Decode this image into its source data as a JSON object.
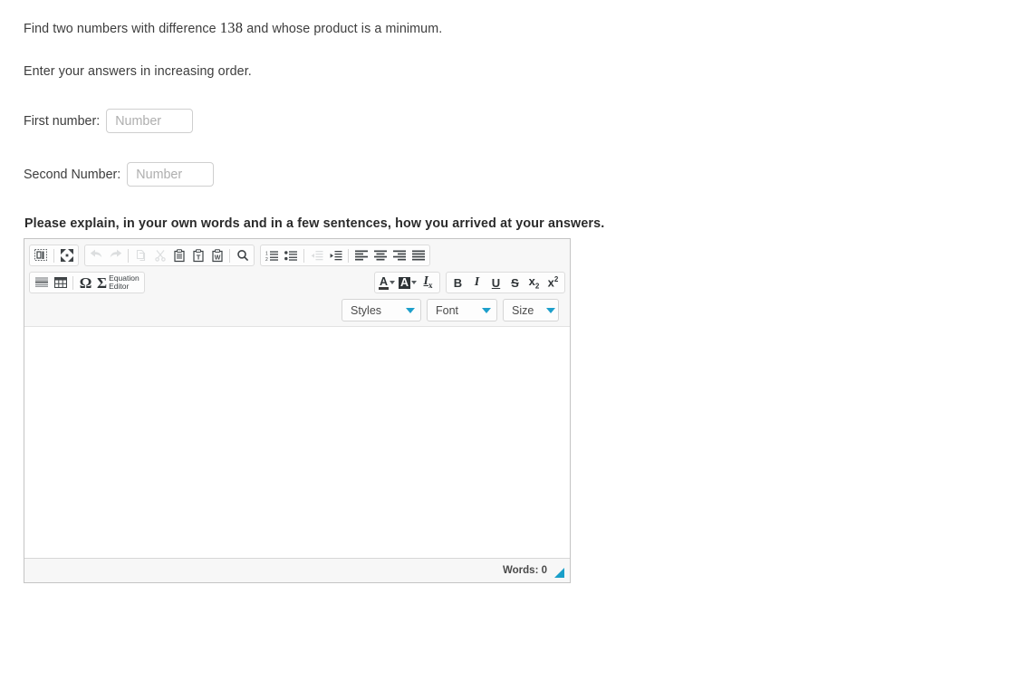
{
  "question": {
    "line1_before": "Find two numbers with difference ",
    "line1_number": "138",
    "line1_after": " and whose product is a minimum.",
    "line2": "Enter your answers in increasing order."
  },
  "answers": {
    "first_label": "First number:",
    "first_value": "",
    "first_placeholder": "Number",
    "second_label": "Second Number:",
    "second_value": "",
    "second_placeholder": "Number"
  },
  "explain": {
    "heading": "Please explain, in your own words and in a few sentences, how you arrived at your answers."
  },
  "editor": {
    "body_text": "",
    "word_count_label": "Words: 0",
    "toolbar": {
      "row1": {
        "group_view": [
          {
            "name": "show-blocks-icon",
            "title": "Show Blocks",
            "disabled": false
          },
          {
            "name": "maximize-icon",
            "title": "Maximize",
            "disabled": false
          }
        ],
        "group_clipboard": [
          {
            "name": "undo-icon",
            "title": "Undo",
            "disabled": true
          },
          {
            "name": "redo-icon",
            "title": "Redo",
            "disabled": true
          },
          {
            "name": "copy-icon",
            "title": "Copy",
            "disabled": true
          },
          {
            "name": "cut-icon",
            "title": "Cut",
            "disabled": true
          },
          {
            "name": "paste-icon",
            "title": "Paste",
            "disabled": false
          },
          {
            "name": "paste-text-icon",
            "title": "Paste as plain text",
            "disabled": false
          },
          {
            "name": "paste-word-icon",
            "title": "Paste from Word",
            "disabled": false
          },
          {
            "name": "search-icon",
            "title": "Find",
            "disabled": false
          }
        ],
        "group_paragraph": [
          {
            "name": "numbered-list-icon",
            "title": "Insert/Remove Numbered List",
            "disabled": false
          },
          {
            "name": "bulleted-list-icon",
            "title": "Insert/Remove Bulleted List",
            "disabled": false
          },
          {
            "name": "outdent-icon",
            "title": "Decrease Indent",
            "disabled": true
          },
          {
            "name": "indent-icon",
            "title": "Increase Indent",
            "disabled": false
          },
          {
            "name": "align-left-icon",
            "title": "Align Left",
            "disabled": false
          },
          {
            "name": "align-center-icon",
            "title": "Center",
            "disabled": false
          },
          {
            "name": "align-right-icon",
            "title": "Align Right",
            "disabled": false
          },
          {
            "name": "justify-icon",
            "title": "Justify",
            "disabled": false
          }
        ]
      },
      "row2": {
        "group_insert": [
          {
            "name": "horizontal-rule-icon",
            "title": "Insert Horizontal Line",
            "disabled": false
          },
          {
            "name": "table-icon",
            "title": "Table",
            "disabled": false
          },
          {
            "name": "special-char-icon",
            "title": "Insert Special Character",
            "label": "Ω",
            "disabled": false
          }
        ],
        "equation_editor": {
          "name": "equation-editor-button",
          "sigma": "Σ",
          "label_line1": "Equation",
          "label_line2": "Editor"
        },
        "group_colors": [
          {
            "name": "text-color-icon",
            "title": "Text Color",
            "letter": "A"
          },
          {
            "name": "background-color-icon",
            "title": "Background Color",
            "letter": "A"
          },
          {
            "name": "remove-format-icon",
            "title": "Remove Format",
            "letter": "I",
            "sub": "x"
          }
        ],
        "group_basic_styles": [
          {
            "name": "bold-icon",
            "title": "Bold",
            "label": "B"
          },
          {
            "name": "italic-icon",
            "title": "Italic",
            "label": "I"
          },
          {
            "name": "underline-icon",
            "title": "Underline",
            "label": "U"
          },
          {
            "name": "strikethrough-icon",
            "title": "Strikethrough",
            "label": "S"
          },
          {
            "name": "subscript-icon",
            "title": "Subscript",
            "label": "x",
            "script": "2"
          },
          {
            "name": "superscript-icon",
            "title": "Superscript",
            "label": "x",
            "script": "2"
          }
        ]
      },
      "row3": {
        "styles_combo": "Styles",
        "font_combo": "Font",
        "size_combo": "Size"
      }
    }
  },
  "colors": {
    "accent_teal": "#199fc9",
    "toolbar_bg": "#f7f7f7",
    "border": "#c4c4c4",
    "text": "#3d3d3d"
  }
}
